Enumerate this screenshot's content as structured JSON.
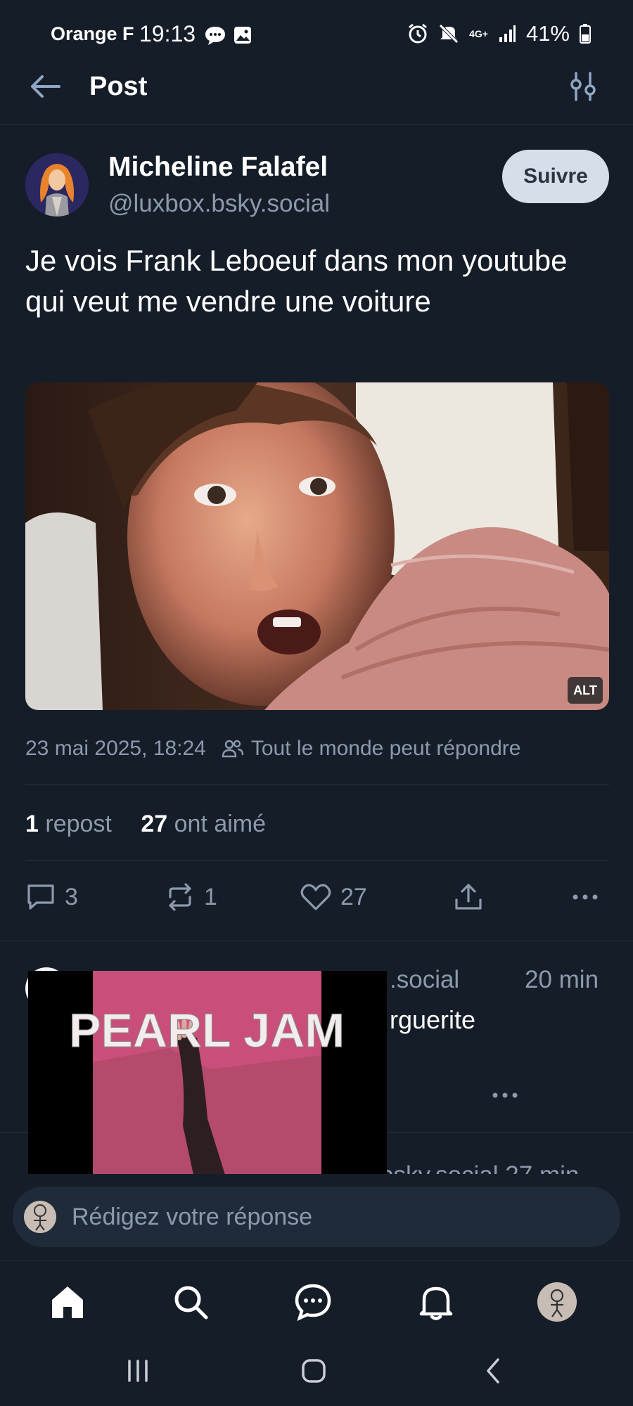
{
  "status_bar": {
    "carrier": "Orange F",
    "time": "19:13",
    "network": "4G+",
    "battery": "41%"
  },
  "header": {
    "title": "Post",
    "back_icon": "arrow-left-icon",
    "filter_icon": "sliders-icon"
  },
  "post": {
    "author_name": "Micheline Falafel",
    "author_handle": "@luxbox.bsky.social",
    "follow_label": "Suivre",
    "text": "Je vois Frank Leboeuf dans mon youtube qui veut me vendre une voiture",
    "image_alt_badge": "ALT",
    "date": "23 mai 2025, 18:24",
    "reply_setting": "Tout le monde peut répondre",
    "reposts_count": "1",
    "reposts_label": "repost",
    "likes_count": "27",
    "likes_label": "ont aimé",
    "actions": {
      "reply_count": "3",
      "repost_count": "1",
      "like_count": "27"
    }
  },
  "replies": [
    {
      "handle_fragment": ".social",
      "time": "20 min",
      "text_fragment": "rguerite",
      "video_overlay": "PEARL JAM"
    },
    {
      "peek_text": "bsky.social 27 min"
    }
  ],
  "composer": {
    "placeholder": "Rédigez votre réponse"
  },
  "colors": {
    "background": "#151d28",
    "muted_text": "#8c9aad",
    "follow_button": "#d5dee9"
  }
}
